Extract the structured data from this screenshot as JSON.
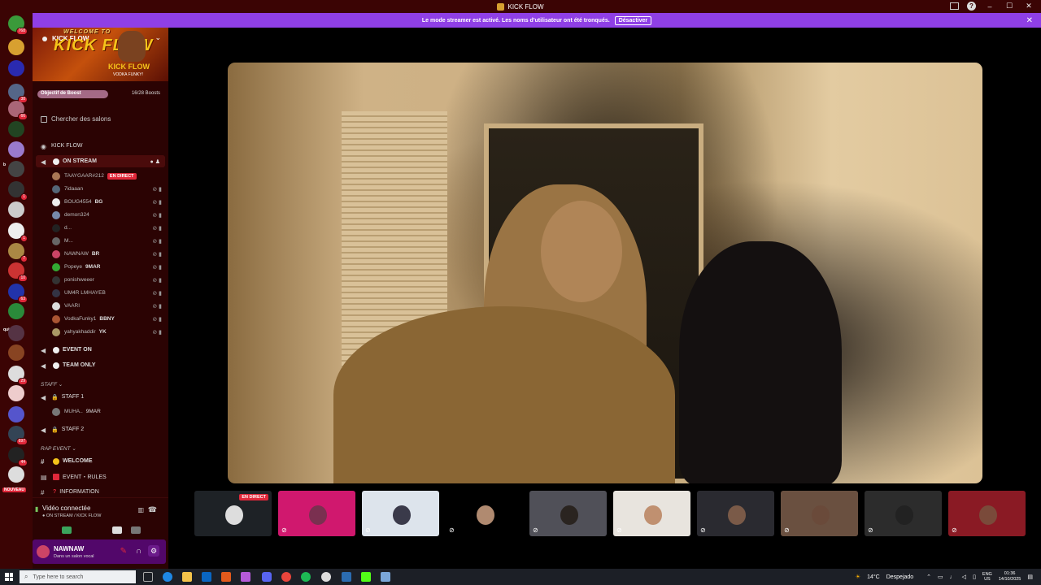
{
  "window": {
    "title": "KICK FLOW"
  },
  "banner": {
    "text": "Le mode streamer est activé. Les noms d'utilisateur ont été tronqués.",
    "button": "Désactiver"
  },
  "rail": {
    "servers": [
      {
        "badge": "768",
        "color": "#3a9a3a"
      },
      {
        "badge": "",
        "color": "#d8a030"
      },
      {
        "badge": "",
        "color": "#2a2ab0"
      },
      {
        "badge": "38",
        "color": "#556688"
      },
      {
        "badge": "66",
        "color": "#aa6677"
      },
      {
        "badge": "",
        "color": "#224422"
      },
      {
        "badge": "",
        "color": "#9a7acc"
      },
      {
        "badge": "",
        "color": "#444444"
      },
      {
        "badge": "1",
        "color": "#333333"
      },
      {
        "badge": "",
        "color": "#cccccc"
      },
      {
        "badge": "1",
        "color": "#eeeeee"
      },
      {
        "badge": "7",
        "color": "#aa8844"
      },
      {
        "badge": "10",
        "color": "#cc3333"
      },
      {
        "badge": "63",
        "color": "#2233aa"
      },
      {
        "badge": "",
        "color": "#2a8a3a"
      },
      {
        "badge": "",
        "color": "#553344"
      },
      {
        "badge": "",
        "color": "#884422"
      },
      {
        "badge": "29",
        "color": "#dddddd"
      },
      {
        "badge": "",
        "color": "#eecccc"
      },
      {
        "badge": "",
        "color": "#5555cc"
      },
      {
        "badge": "697",
        "color": "#334455"
      },
      {
        "badge": "44",
        "color": "#222222"
      },
      {
        "badge": "",
        "color": "#dddddd"
      }
    ],
    "b_label": "b",
    "quinn_label": "quinn",
    "new_label": "NOUVEAU"
  },
  "server": {
    "name": "KICK FLOW",
    "logo_top": "WELCOME TO",
    "logo_main": "KICK FLOW",
    "logo_sub": "KICK FLOW",
    "logo_sub2": "VODKA FUNKY!",
    "boost_label": "Objectif de Boost",
    "boost_count": "16/28 Boosts",
    "search_label": "Chercher des salons",
    "kick_flow_channel": "KICK FLOW"
  },
  "channels": {
    "on_stream": "ON STREAM",
    "event_on": "EVENT ON",
    "team_only": "TEAM ONLY",
    "staff_cat": "STAFF",
    "staff1": "STAFF 1",
    "staff2": "STAFF 2",
    "rap_cat": "RAP EVENT",
    "welcome": "WELCOME",
    "event_rules": "EVENT・RULES",
    "information": "INFORMATION",
    "live_tag": "EN DIRECT"
  },
  "users": [
    {
      "name": "TAAYGAAR#212",
      "color": "#aa7755"
    },
    {
      "name": "7idaaan",
      "color": "#556677"
    },
    {
      "name": "BOUG4554",
      "extra": "BG",
      "color": "#eeeeee"
    },
    {
      "name": "demon324",
      "color": "#7788aa"
    },
    {
      "name": "d...",
      "color": "#222222"
    },
    {
      "name": "M...",
      "color": "#666666"
    },
    {
      "name": "NAWNAW",
      "extra": "BR",
      "color": "#cc4466"
    },
    {
      "name": "Popeye",
      "extra": "9MAR",
      "color": "#33aa33"
    },
    {
      "name": "ponishweeer",
      "color": "#333333"
    },
    {
      "name": "UM4R LMHAYEB",
      "color": "#333344"
    },
    {
      "name": "VAARI",
      "color": "#dddddd"
    },
    {
      "name": "VodkaFunky1",
      "extra": "BBNY",
      "color": "#aa5533"
    },
    {
      "name": "yahyakhaddir",
      "extra": "YK",
      "color": "#aa9966"
    }
  ],
  "staff_user": {
    "name": "MUHA..",
    "extra": "9MAR",
    "color": "#777777"
  },
  "voice": {
    "status": "Vidéo connectée",
    "location": "ON STREAM / KICK FLOW"
  },
  "me": {
    "name": "NAWNAW",
    "status": "Dans un salon vocal"
  },
  "thumbs": [
    {
      "bg": "#1e2226",
      "live": "EN DIRECT"
    },
    {
      "bg": "#d0186e"
    },
    {
      "bg": "#dde4ec"
    },
    {
      "bg": "#000000"
    },
    {
      "bg": "#505058"
    },
    {
      "bg": "#e8e4de"
    },
    {
      "bg": "#2a2a30"
    },
    {
      "bg": "#6a5040"
    },
    {
      "bg": "#2c2c2c"
    },
    {
      "bg": "#8a1a24"
    }
  ],
  "taskbar": {
    "search_placeholder": "Type here to search",
    "weather": "14°C",
    "weather_desc": "Despejado",
    "lang1": "ENG",
    "lang2": "US",
    "time": "01:36",
    "date": "14/10/2025"
  }
}
